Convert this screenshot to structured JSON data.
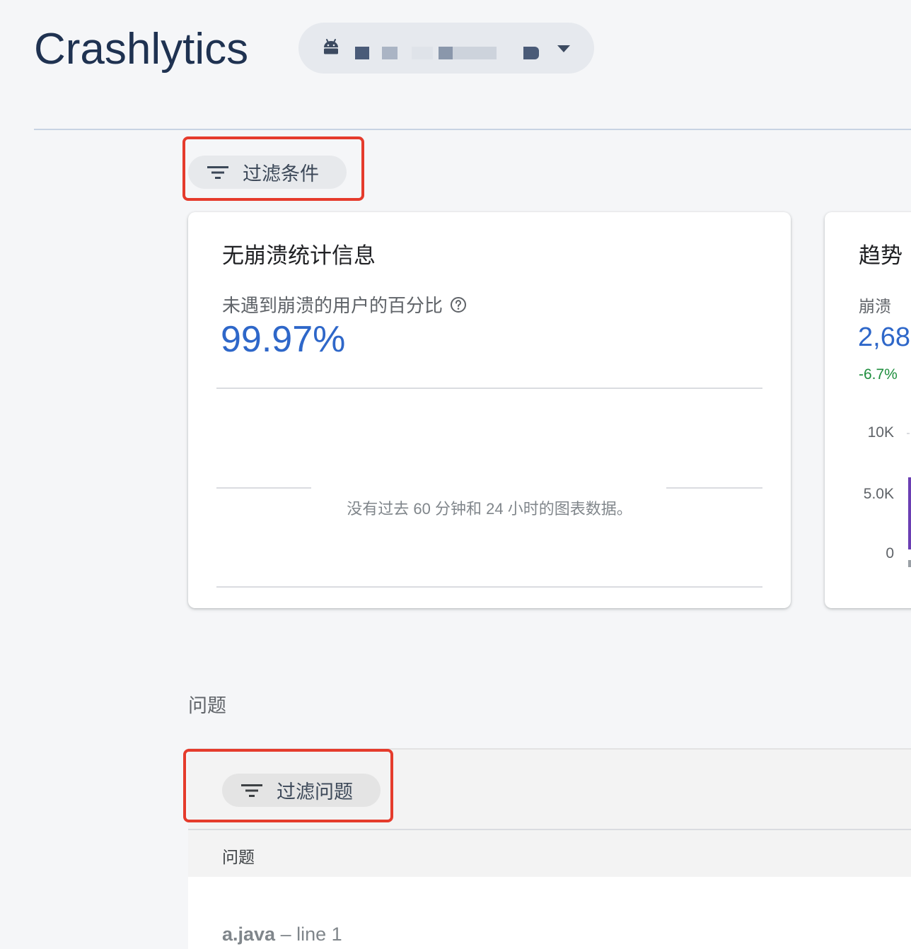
{
  "header": {
    "title": "Crashlytics",
    "app_picker": {
      "icon": "android-icon",
      "dropdown_icon": "arrow-drop-down-icon"
    }
  },
  "filters": {
    "label": "过滤条件",
    "icon": "filter-list-icon"
  },
  "crash_free_card": {
    "title": "无崩溃统计信息",
    "metric_label": "未遇到崩溃的用户的百分比",
    "help_icon": "help-outline-icon",
    "metric_value": "99.97%",
    "empty_message": "没有过去 60 分钟和 24 小时的图表数据。"
  },
  "trends_card": {
    "title": "趋势",
    "metric_label": "崩溃",
    "metric_value": "2,68",
    "delta": "-6.7%",
    "y_axis_ticks": [
      "10K",
      "5.0K",
      "0"
    ]
  },
  "issues": {
    "section_label": "问题",
    "filter_label": "过滤问题",
    "filter_icon": "filter-list-icon",
    "column_header": "问题",
    "rows": [
      {
        "file": "a.java",
        "separator": " – ",
        "line": "line 1"
      }
    ]
  },
  "colors": {
    "accent_blue": "#2e67c9",
    "positive_green": "#1e8e3e",
    "highlight_red": "#e53b2c",
    "title_navy": "#1f3251"
  }
}
